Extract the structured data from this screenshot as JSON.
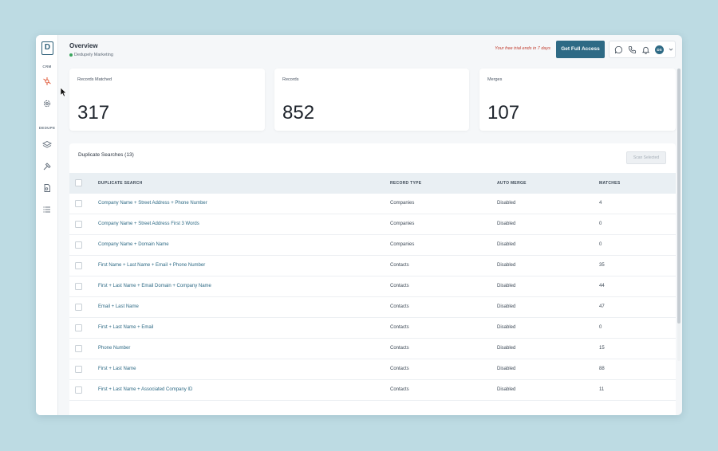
{
  "sidebar": {
    "logo_letter": "D",
    "crm_label": "CRM",
    "dedupe_label": "DEDUPE"
  },
  "header": {
    "title": "Overview",
    "subtitle": "Dedupely Marketing",
    "trial_text": "Your free trial ends in 7 days",
    "cta_label": "Get Full Access",
    "avatar_initials": "DS"
  },
  "stats": [
    {
      "label": "Records Matched",
      "value": "317"
    },
    {
      "label": "Records",
      "value": "852"
    },
    {
      "label": "Merges",
      "value": "107"
    }
  ],
  "panel": {
    "title": "Duplicate Searches (13)",
    "scan_label": "Scan Selected",
    "columns": [
      "DUPLICATE SEARCH",
      "RECORD TYPE",
      "AUTO MERGE",
      "MATCHES"
    ],
    "rows": [
      {
        "search": "Company Name + Street Address + Phone Number",
        "type": "Companies",
        "auto": "Disabled",
        "matches": "4"
      },
      {
        "search": "Company Name + Street Address First 3 Words",
        "type": "Companies",
        "auto": "Disabled",
        "matches": "0"
      },
      {
        "search": "Company Name + Domain Name",
        "type": "Companies",
        "auto": "Disabled",
        "matches": "0"
      },
      {
        "search": "First Name + Last Name + Email + Phone Number",
        "type": "Contacts",
        "auto": "Disabled",
        "matches": "35"
      },
      {
        "search": "First + Last Name + Email Domain + Company Name",
        "type": "Contacts",
        "auto": "Disabled",
        "matches": "44"
      },
      {
        "search": "Email + Last Name",
        "type": "Contacts",
        "auto": "Disabled",
        "matches": "47"
      },
      {
        "search": "First + Last Name + Email",
        "type": "Contacts",
        "auto": "Disabled",
        "matches": "0"
      },
      {
        "search": "Phone Number",
        "type": "Contacts",
        "auto": "Disabled",
        "matches": "15"
      },
      {
        "search": "First + Last Name",
        "type": "Contacts",
        "auto": "Disabled",
        "matches": "88"
      },
      {
        "search": "First + Last Name + Associated Company ID",
        "type": "Contacts",
        "auto": "Disabled",
        "matches": "11"
      }
    ]
  },
  "colors": {
    "accent": "#2e6a85",
    "background": "#bddbe3",
    "trial_text": "#c0392b"
  }
}
